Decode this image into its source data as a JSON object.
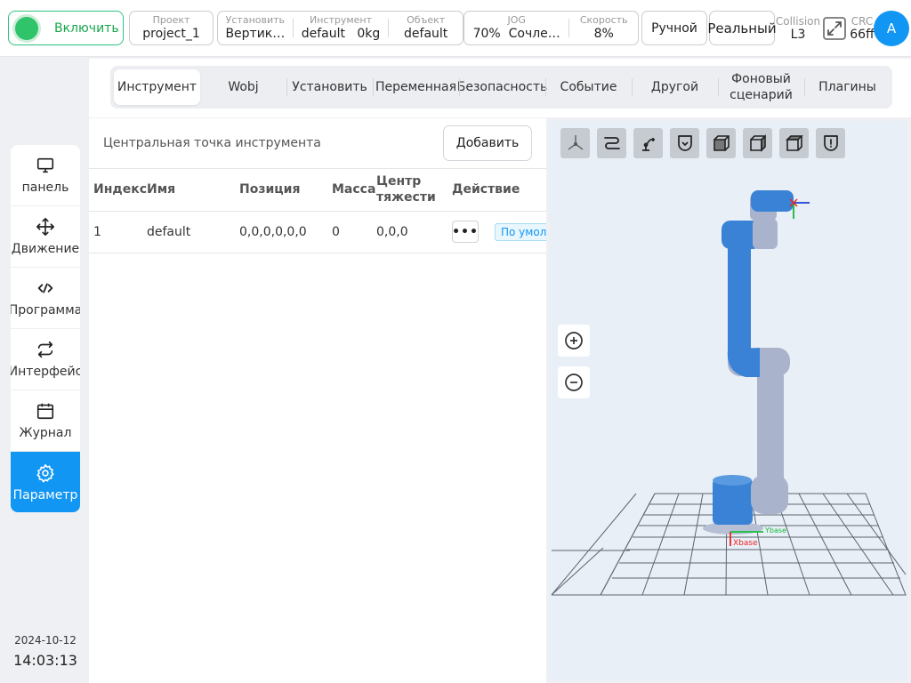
{
  "topbar": {
    "power_label": "Включить",
    "project": {
      "label": "Проект",
      "value": "project_1"
    },
    "install": {
      "label": "Установить",
      "value": "Вертик…"
    },
    "tool": {
      "label": "Инструмент",
      "value": "default",
      "payload": "0kg"
    },
    "wobj": {
      "label": "Объект",
      "value": "default"
    },
    "jog": {
      "label": "JOG",
      "percent": "70%",
      "mode": "Сочле…"
    },
    "speed": {
      "label": "Скорость",
      "value": "8%"
    },
    "manual_label": "Ручной",
    "real_label": "Реальный",
    "collision": {
      "label": "Collision",
      "value": "L3"
    },
    "crc": {
      "label": "CRC",
      "value": "66ff"
    },
    "avatar": "A"
  },
  "sidebar": {
    "items": [
      {
        "label": "панель",
        "icon": "monitor-icon"
      },
      {
        "label": "Движение",
        "icon": "move-icon"
      },
      {
        "label": "Программа",
        "icon": "code-icon"
      },
      {
        "label": "Интерфейс",
        "icon": "swap-icon"
      },
      {
        "label": "Журнал",
        "icon": "calendar-icon"
      },
      {
        "label": "Параметр",
        "icon": "gear-icon",
        "active": true
      }
    ],
    "date": "2024-10-12",
    "time": "14:03:13"
  },
  "tabs": [
    "Инструмент",
    "Wobj",
    "Установить",
    "Переменная",
    "Безопасность",
    "Событие",
    "Другой",
    "Фоновый сценарий",
    "Плагины"
  ],
  "panel": {
    "title": "Центральная точка инструмента",
    "add_label": "Добавить",
    "columns": [
      "Индекс",
      "Имя",
      "Позиция",
      "Масса",
      "Центр тяжести",
      "Действие"
    ],
    "rows": [
      {
        "index": "1",
        "name": "default",
        "position": "0,0,0,0,0,0",
        "mass": "0",
        "cog": "0,0,0",
        "action": "•••",
        "tag": "По умолчанию"
      }
    ]
  },
  "viewport": {
    "tools": [
      "axes-view-icon",
      "path-icon",
      "robot-icon",
      "shield-check-icon",
      "cube-front-icon",
      "cube-side-icon",
      "cube-top-icon",
      "shield-alert-icon"
    ],
    "axis_labels": {
      "tcp_x": "X",
      "base_x": "Xbase",
      "base_y": "Ybase"
    },
    "colors": {
      "accent": "#1296f4",
      "active_green": "#2fc46a",
      "robot_blue": "#3a82d6",
      "robot_gray": "#aab3cc"
    }
  }
}
